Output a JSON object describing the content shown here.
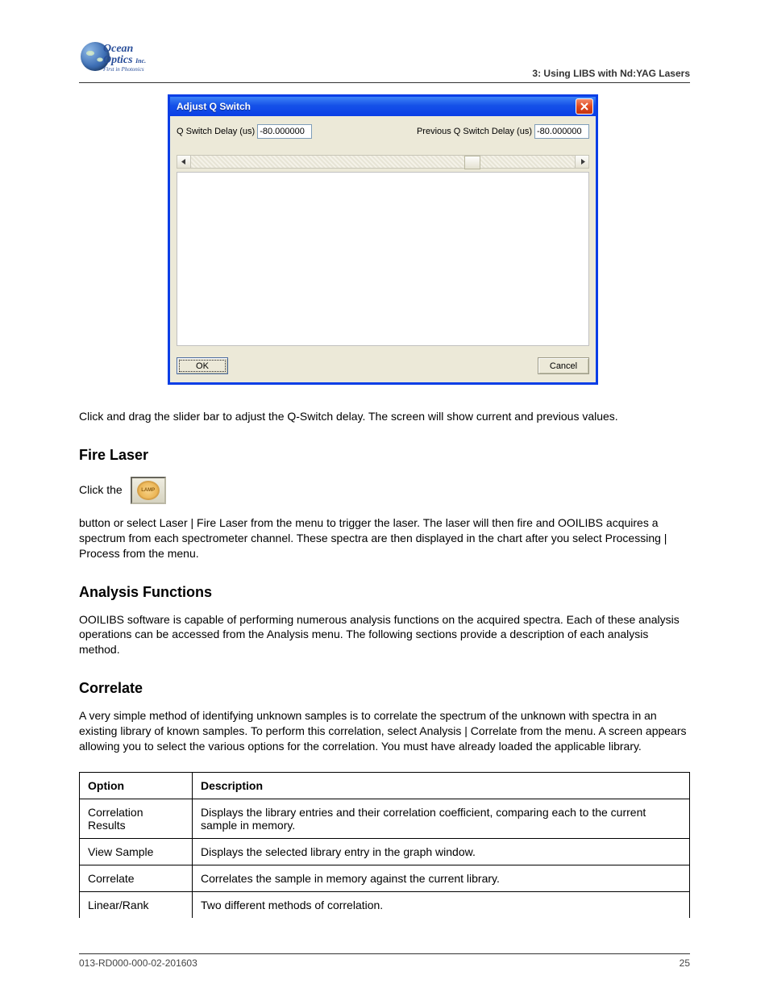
{
  "header": {
    "brand_line1": "Ocean",
    "brand_line2": "Optics",
    "brand_suffix": "Inc.",
    "tagline": "First in Photonics",
    "doc_section": "3: Using LIBS with Nd:YAG Lasers"
  },
  "dialog": {
    "title": "Adjust Q Switch",
    "field1_label": "Q Switch Delay (us)",
    "field1_value": "-80.000000",
    "field2_label": "Previous Q Switch Delay (us)",
    "field2_value": "-80.000000",
    "ok_label": "OK",
    "cancel_label": "Cancel"
  },
  "body": {
    "para1": "Click and drag the slider bar to adjust the Q-Switch delay. The screen will show current and previous values.",
    "fire_heading": "Fire Laser",
    "fire_para_before": "Click the ",
    "lamp_label": "LAMP",
    "fire_para_after": " button or select Laser | Fire Laser from the menu to trigger the laser. The laser will then fire and OOILIBS acquires a spectrum from each spectrometer channel. These spectra are then displayed in the chart after you select Processing | Process from the menu.",
    "analysis_heading": "Analysis Functions",
    "analysis_para": "OOILIBS software is capable of performing numerous analysis functions on the acquired spectra. Each of these analysis operations can be accessed from the Analysis menu. The following sections provide a description of each analysis method.",
    "corr_heading": "Correlate",
    "corr_para": "A very simple method of identifying unknown samples is to correlate the spectrum of the unknown with spectra in an existing library of known samples. To perform this correlation, select Analysis | Correlate from the menu. A screen appears allowing you to select the various options for the correlation. You must have already loaded the applicable library."
  },
  "table": {
    "head_option": "Option",
    "head_desc": "Description",
    "rows": [
      {
        "option": "Correlation Results",
        "desc": "Displays the library entries and their correlation coefficient, comparing each to the current sample in memory."
      },
      {
        "option": "View Sample",
        "desc": "Displays the selected library entry in the graph window."
      },
      {
        "option": "Correlate",
        "desc": "Correlates the sample in memory against the current library."
      },
      {
        "option": "Linear/Rank",
        "desc": "Two different methods of correlation."
      }
    ]
  },
  "footer": {
    "doc_id": "013-RD000-000-02-201603",
    "page": "25"
  }
}
